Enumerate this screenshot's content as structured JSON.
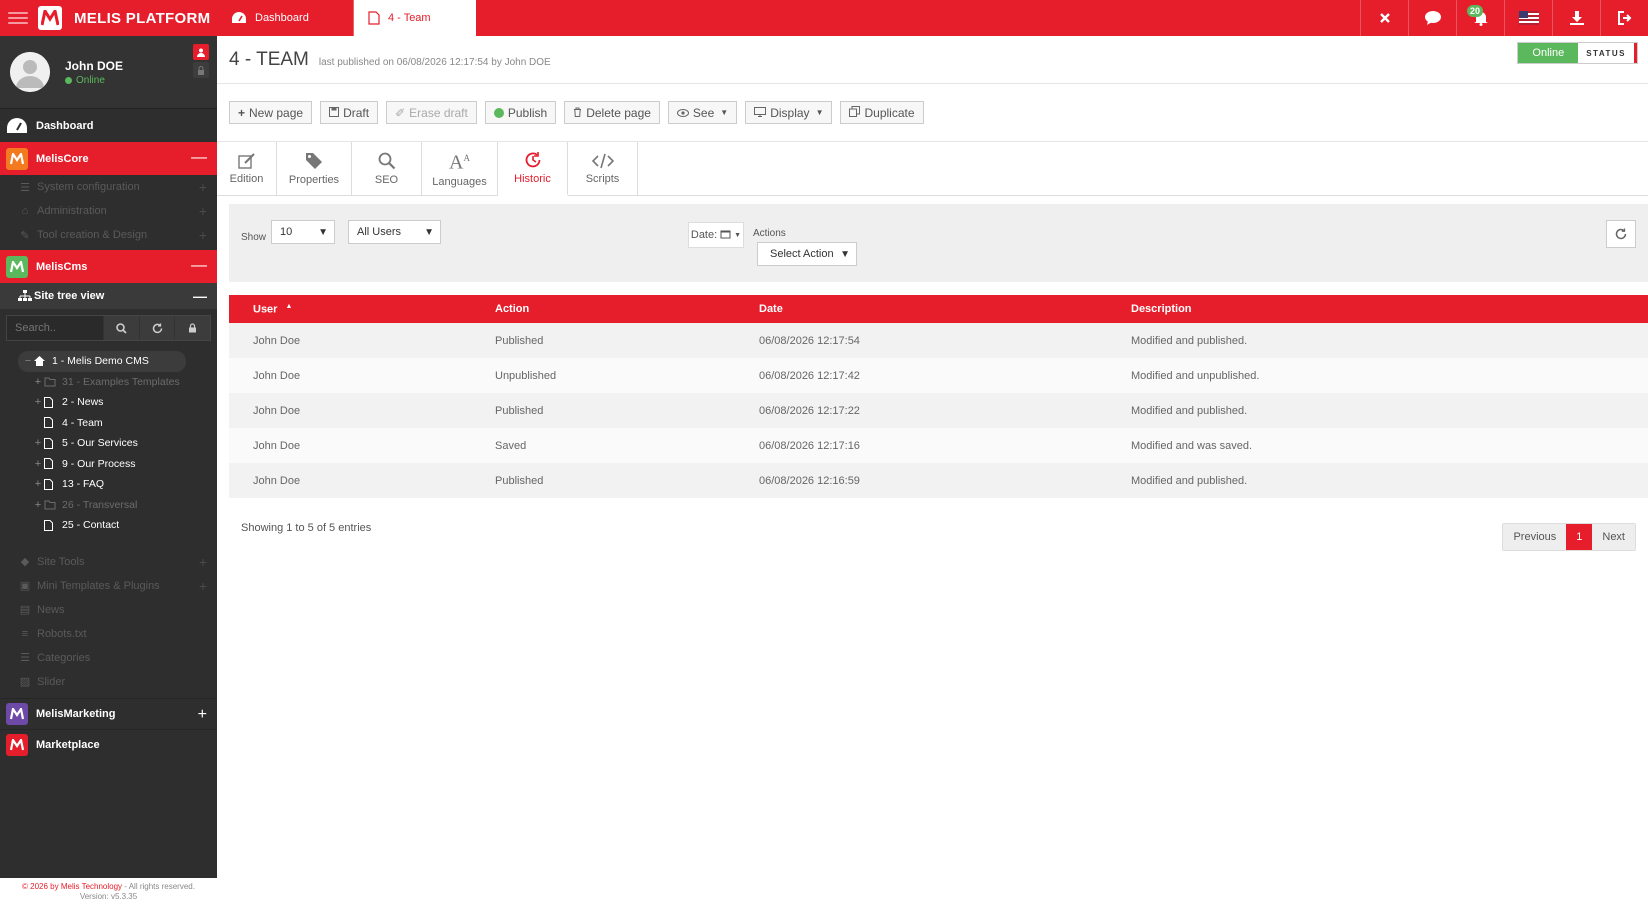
{
  "brand": {
    "name": "MELIS PLATFORM"
  },
  "tabs": [
    {
      "label": "Dashboard",
      "icon": "dashboard-icon"
    },
    {
      "label": "4 - Team",
      "icon": "page-icon"
    }
  ],
  "top_icons": {
    "notification_count": "20"
  },
  "user": {
    "name": "John DOE",
    "status": "Online"
  },
  "sidebar": {
    "dashboard": "Dashboard",
    "melis_core": "MelisCore",
    "core_items": [
      "System configuration",
      "Administration",
      "Tool creation & Design"
    ],
    "melis_cms": "MelisCms",
    "site_tree": "Site tree view",
    "search_placeholder": "Search..",
    "tree": {
      "root": "1 - Melis Demo CMS",
      "items": [
        "31 - Examples Templates",
        "2 - News",
        "4 - Team",
        "5 - Our Services",
        "9 - Our Process",
        "13 - FAQ",
        "26 - Transversal",
        "25 - Contact"
      ]
    },
    "cms_tools": [
      "Site Tools",
      "Mini Templates & Plugins",
      "News",
      "Robots.txt",
      "Categories",
      "Slider"
    ],
    "melis_marketing": "MelisMarketing",
    "marketplace": "Marketplace",
    "footer_copyright": "© 2026 by Melis Technology",
    "footer_rights": " - All rights reserved.",
    "footer_version": "Version: v5.3.35"
  },
  "page": {
    "title": "4 - TEAM",
    "subtitle": "last published on 06/08/2026 12:17:54 by John DOE",
    "status_value": "Online",
    "status_label": "STATUS"
  },
  "toolbar": {
    "new_page": "New page",
    "draft": "Draft",
    "erase_draft": "Erase draft",
    "publish": "Publish",
    "delete_page": "Delete page",
    "see": "See",
    "display": "Display",
    "duplicate": "Duplicate"
  },
  "page_tabs": [
    "Edition",
    "Properties",
    "SEO",
    "Languages",
    "Historic",
    "Scripts"
  ],
  "filters": {
    "show_label": "Show",
    "show_value": "10",
    "users_value": "All Users",
    "date_label": "Date:",
    "actions_label": "Actions",
    "select_action": "Select Action"
  },
  "table": {
    "headers": [
      "User",
      "Action",
      "Date",
      "Description"
    ],
    "rows": [
      [
        "John Doe",
        "Published",
        "06/08/2026 12:17:54",
        "Modified and published."
      ],
      [
        "John Doe",
        "Unpublished",
        "06/08/2026 12:17:42",
        "Modified and unpublished."
      ],
      [
        "John Doe",
        "Published",
        "06/08/2026 12:17:22",
        "Modified and published."
      ],
      [
        "John Doe",
        "Saved",
        "06/08/2026 12:17:16",
        "Modified and was saved."
      ],
      [
        "John Doe",
        "Published",
        "06/08/2026 12:16:59",
        "Modified and published."
      ]
    ]
  },
  "pagination": {
    "info": "Showing 1 to 5 of 5 entries",
    "previous": "Previous",
    "current": "1",
    "next": "Next"
  },
  "colors": {
    "accent": "#e61d2b",
    "online": "#5cb85c",
    "sidebar": "#2e2e2e"
  }
}
